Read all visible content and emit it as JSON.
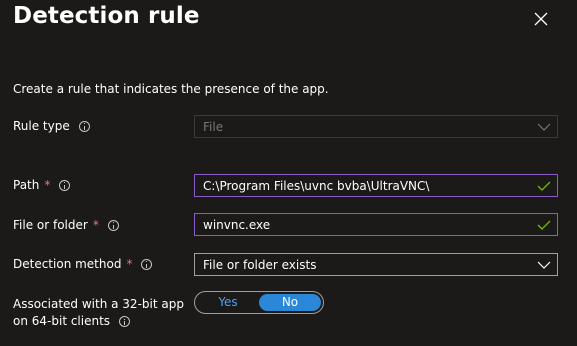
{
  "panel": {
    "title": "Detection rule",
    "close_icon": "close-icon",
    "description": "Create a rule that indicates the presence of the app."
  },
  "rule_type": {
    "label": "Rule type",
    "value": "File",
    "disabled": true
  },
  "path": {
    "label": "Path",
    "required": "*",
    "value": "C:\\Program Files\\uvnc bvba\\UltraVNC\\",
    "valid": true
  },
  "file_or_folder": {
    "label": "File or folder",
    "required": "*",
    "value": "winvnc.exe",
    "valid": true
  },
  "detection_method": {
    "label": "Detection method",
    "required": "*",
    "value": "File or folder exists"
  },
  "associated_32bit": {
    "label_line1": "Associated with a 32-bit app",
    "label_line2": "on 64-bit clients",
    "option_yes": "Yes",
    "option_no": "No",
    "selected": "No"
  },
  "colors": {
    "background": "#1b1a19",
    "accent": "#2b88d8",
    "required_star": "#f1707b",
    "valid_check": "#6bb700",
    "focus_border": "#8a5cc9"
  }
}
